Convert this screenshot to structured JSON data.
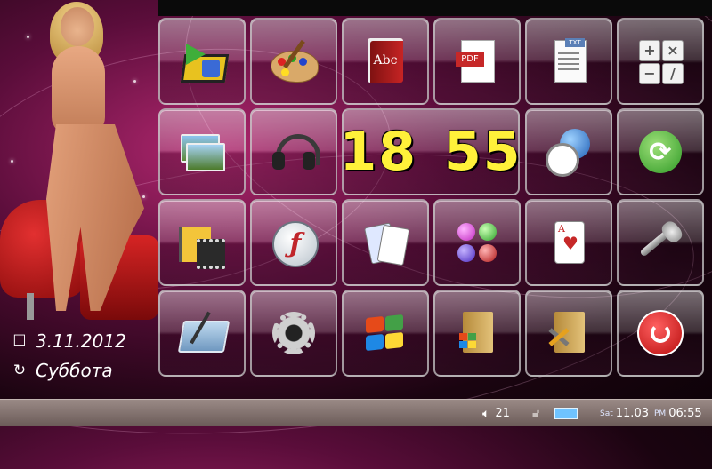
{
  "clock": {
    "hours": "18",
    "minutes": "55"
  },
  "date_widget": {
    "date": "3.11.2012",
    "weekday": "Суббота"
  },
  "tiles": {
    "pdf_label": "PDF",
    "book_label": "Abc",
    "txt_label": "TXT",
    "calc_keys": [
      "+",
      "×",
      "−",
      "/"
    ],
    "ace_label": "A"
  },
  "statusbar": {
    "volume": "21",
    "day_prefix": "Sat",
    "date": "11.03",
    "ampm": "PM",
    "time": "06:55",
    "battery_color": "#6fc3ff"
  }
}
